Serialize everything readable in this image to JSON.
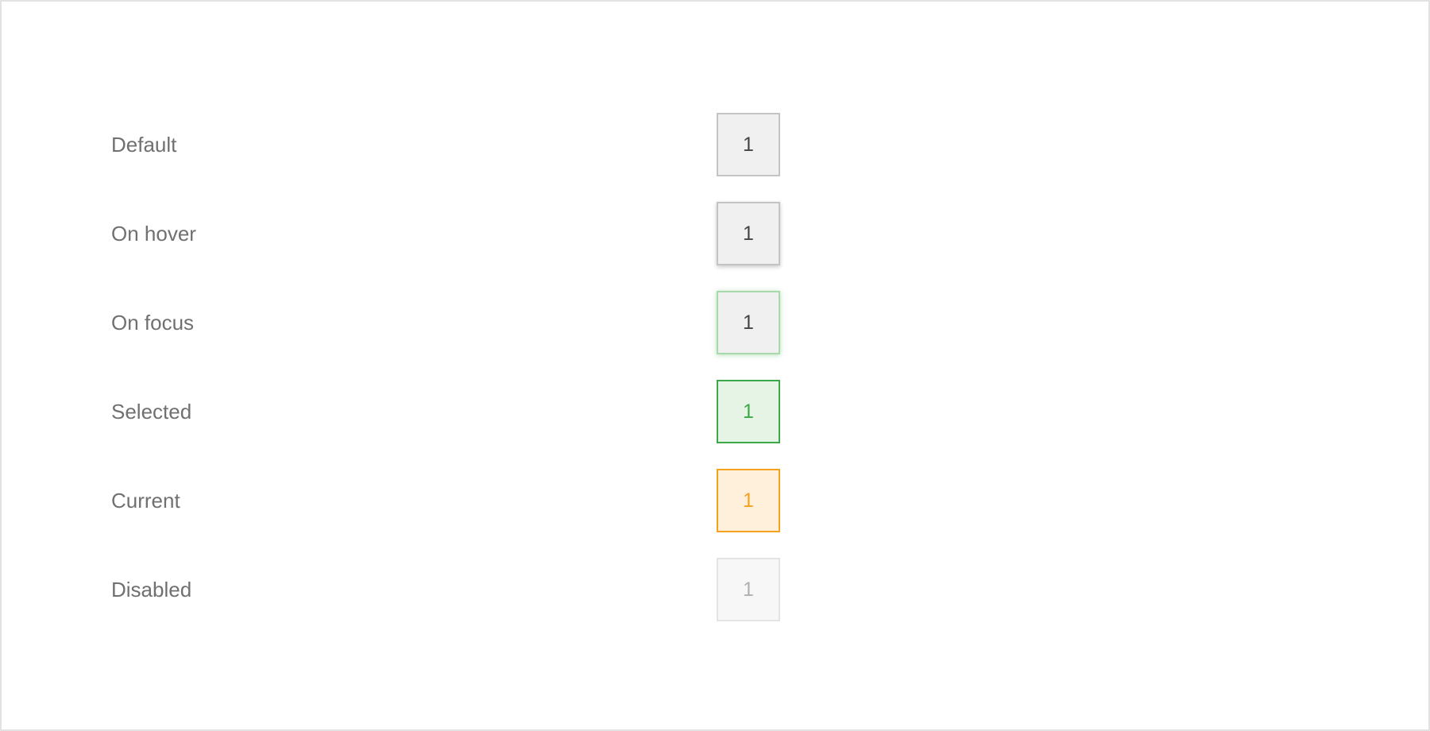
{
  "states": [
    {
      "label": "Default",
      "value": "1"
    },
    {
      "label": "On hover",
      "value": "1"
    },
    {
      "label": "On focus",
      "value": "1"
    },
    {
      "label": "Selected",
      "value": "1"
    },
    {
      "label": "Current",
      "value": "1"
    },
    {
      "label": "Disabled",
      "value": "1"
    }
  ],
  "colors": {
    "default_border": "#c4c4c4",
    "default_background": "#f0f0f0",
    "focus_border": "#a8d9ad",
    "selected_accent": "#3da84a",
    "selected_background": "#e6f4e6",
    "current_accent": "#f5a21f",
    "current_background": "#fff0dc",
    "disabled_text": "#b0b0b0",
    "label_text": "#707070"
  }
}
